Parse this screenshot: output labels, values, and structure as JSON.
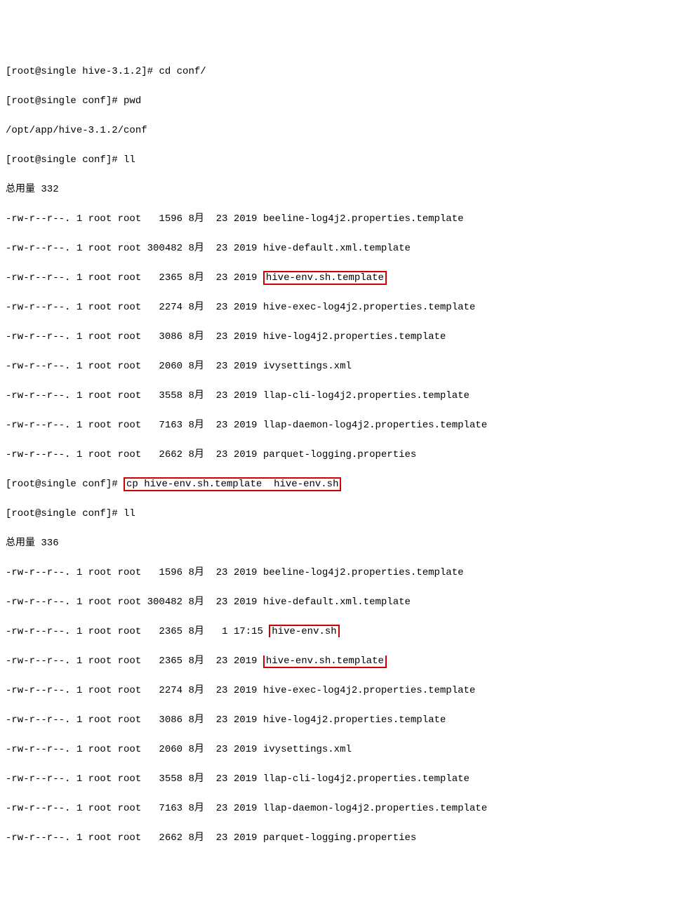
{
  "prompt1": "[root@single hive-3.1.2]# ",
  "cmd1": "cd conf/",
  "prompt2": "[root@single conf]# ",
  "cmd2": "pwd",
  "pwd_output": "/opt/app/hive-3.1.2/conf",
  "cmd3": "ll",
  "total1": "总用量 332",
  "listing1": [
    {
      "perm": "-rw-r--r--. 1 root root   1596 8月  23 2019 ",
      "name": "beeline-log4j2.properties.template"
    },
    {
      "perm": "-rw-r--r--. 1 root root 300482 8月  23 2019 ",
      "name": "hive-default.xml.template"
    },
    {
      "perm": "-rw-r--r--. 1 root root   2365 8月  23 2019 ",
      "name": "hive-env.sh.template"
    },
    {
      "perm": "-rw-r--r--. 1 root root   2274 8月  23 2019 ",
      "name": "hive-exec-log4j2.properties.template"
    },
    {
      "perm": "-rw-r--r--. 1 root root   3086 8月  23 2019 ",
      "name": "hive-log4j2.properties.template"
    },
    {
      "perm": "-rw-r--r--. 1 root root   2060 8月  23 2019 ",
      "name": "ivysettings.xml"
    },
    {
      "perm": "-rw-r--r--. 1 root root   3558 8月  23 2019 ",
      "name": "llap-cli-log4j2.properties.template"
    },
    {
      "perm": "-rw-r--r--. 1 root root   7163 8月  23 2019 ",
      "name": "llap-daemon-log4j2.properties.template"
    },
    {
      "perm": "-rw-r--r--. 1 root root   2662 8月  23 2019 ",
      "name": "parquet-logging.properties"
    }
  ],
  "cmd4": "cp hive-env.sh.template  hive-env.sh",
  "cmd5": "ll",
  "total2": "总用量 336",
  "listing2": [
    {
      "perm": "-rw-r--r--. 1 root root   1596 8月  23 2019 ",
      "name": "beeline-log4j2.properties.template"
    },
    {
      "perm": "-rw-r--r--. 1 root root 300482 8月  23 2019 ",
      "name": "hive-default.xml.template"
    },
    {
      "perm": "-rw-r--r--. 1 root root   2365 8月   1 17:15 ",
      "name": "hive-env.sh"
    },
    {
      "perm": "-rw-r--r--. 1 root root   2365 8月  23 2019 ",
      "name": "hive-env.sh.template"
    },
    {
      "perm": "-rw-r--r--. 1 root root   2274 8月  23 2019 ",
      "name": "hive-exec-log4j2.properties.template"
    },
    {
      "perm": "-rw-r--r--. 1 root root   3086 8月  23 2019 ",
      "name": "hive-log4j2.properties.template"
    },
    {
      "perm": "-rw-r--r--. 1 root root   2060 8月  23 2019 ",
      "name": "ivysettings.xml"
    },
    {
      "perm": "-rw-r--r--. 1 root root   3558 8月  23 2019 ",
      "name": "llap-cli-log4j2.properties.template"
    },
    {
      "perm": "-rw-r--r--. 1 root root   7163 8月  23 2019 ",
      "name": "llap-daemon-log4j2.properties.template"
    },
    {
      "perm": "-rw-r--r--. 1 root root   2662 8月  23 2019 ",
      "name": "parquet-logging.properties"
    }
  ]
}
